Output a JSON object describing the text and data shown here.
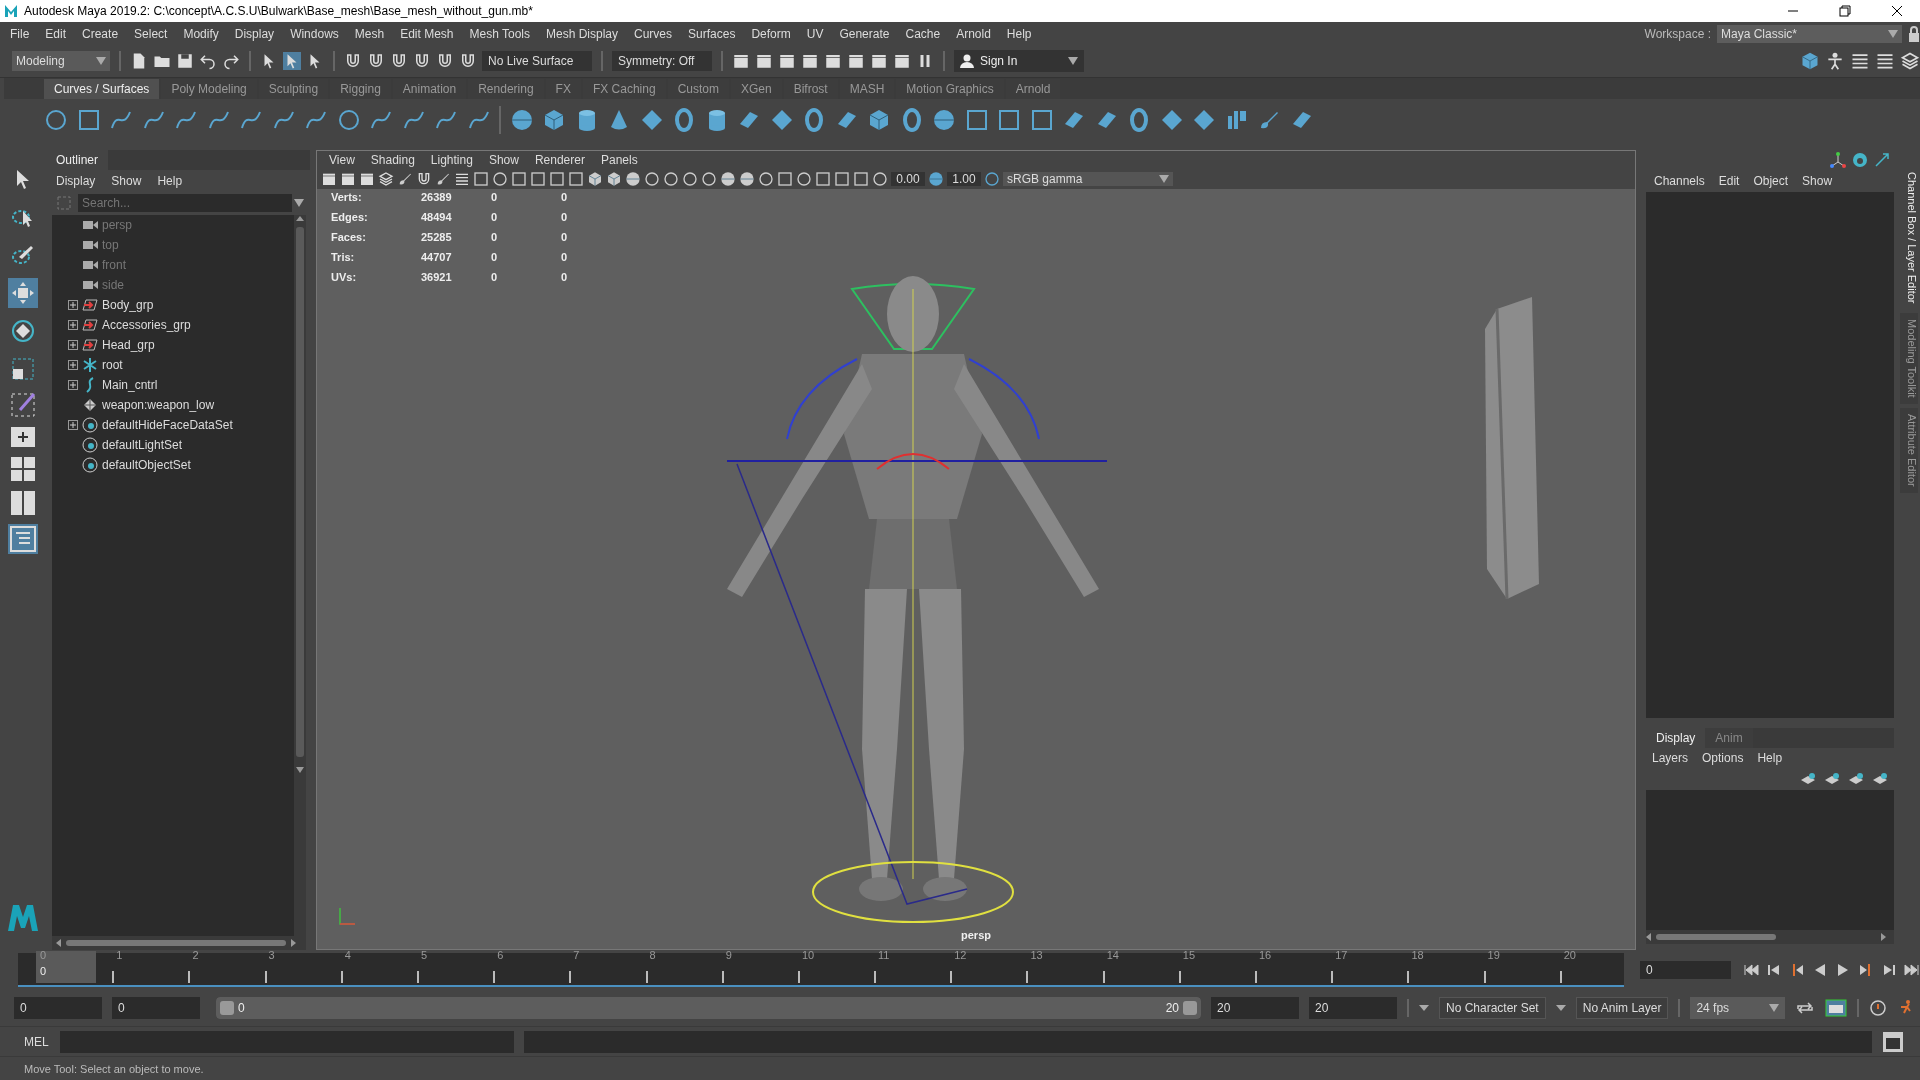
{
  "window": {
    "title": "Autodesk Maya 2019.2: C:\\concept\\A.C.S.U\\Bulwark\\Base_mesh\\Base_mesh_without_gun.mb*"
  },
  "menu_bar": [
    "File",
    "Edit",
    "Create",
    "Select",
    "Modify",
    "Display",
    "Windows",
    "Mesh",
    "Edit Mesh",
    "Mesh Tools",
    "Mesh Display",
    "Curves",
    "Surfaces",
    "Deform",
    "UV",
    "Generate",
    "Cache",
    "Arnold",
    "Help"
  ],
  "status_line": {
    "mode": "Modeling",
    "live_surface": "No Live Surface",
    "symmetry": "Symmetry: Off",
    "sign_in": "Sign In",
    "workspace_label": "Workspace :",
    "workspace": "Maya Classic*"
  },
  "shelf": {
    "tabs": [
      {
        "label": "Curves / Surfaces",
        "selected": true
      },
      {
        "label": "Poly Modeling",
        "selected": false
      },
      {
        "label": "Sculpting",
        "selected": false
      },
      {
        "label": "Rigging",
        "selected": false
      },
      {
        "label": "Animation",
        "selected": false
      },
      {
        "label": "Rendering",
        "selected": false
      },
      {
        "label": "FX",
        "selected": false
      },
      {
        "label": "FX Caching",
        "selected": false
      },
      {
        "label": "Custom",
        "selected": false
      },
      {
        "label": "XGen",
        "selected": false
      },
      {
        "label": "Bifrost",
        "selected": false
      },
      {
        "label": "MASH",
        "selected": false
      },
      {
        "label": "Motion Graphics",
        "selected": false
      },
      {
        "label": "Arnold",
        "selected": false
      }
    ]
  },
  "toolbox": [
    {
      "kind": "select",
      "selected": false
    },
    {
      "kind": "lasso",
      "selected": false
    },
    {
      "kind": "paint",
      "selected": false
    },
    {
      "kind": "move",
      "selected": true
    },
    {
      "kind": "rotate",
      "selected": false
    },
    {
      "kind": "scale",
      "selected": false
    }
  ],
  "outliner": {
    "title": "Outliner",
    "menu": [
      "Display",
      "Show",
      "Help"
    ],
    "search": {
      "placeholder": "Search..."
    },
    "items": [
      {
        "label": "persp",
        "kind": "camera",
        "expandable": false,
        "hidden": true
      },
      {
        "label": "top",
        "kind": "camera",
        "expandable": false,
        "hidden": true
      },
      {
        "label": "front",
        "kind": "camera",
        "expandable": false,
        "hidden": true
      },
      {
        "label": "side",
        "kind": "camera",
        "expandable": false,
        "hidden": true
      },
      {
        "label": "Body_grp",
        "kind": "group",
        "expandable": true,
        "hidden": false
      },
      {
        "label": "Accessories_grp",
        "kind": "group",
        "expandable": true,
        "hidden": false
      },
      {
        "label": "Head_grp",
        "kind": "group",
        "expandable": true,
        "hidden": false
      },
      {
        "label": "root",
        "kind": "joint",
        "expandable": true,
        "hidden": false
      },
      {
        "label": "Main_cntrl",
        "kind": "curve",
        "expandable": true,
        "hidden": false
      },
      {
        "label": "weapon:weapon_low",
        "kind": "mesh",
        "expandable": false,
        "hidden": false
      },
      {
        "label": "defaultHideFaceDataSet",
        "kind": "set",
        "expandable": true,
        "hidden": false
      },
      {
        "label": "defaultLightSet",
        "kind": "set",
        "expandable": false,
        "hidden": false
      },
      {
        "label": "defaultObjectSet",
        "kind": "set",
        "expandable": false,
        "hidden": false
      }
    ]
  },
  "viewport": {
    "menu": [
      "View",
      "Shading",
      "Lighting",
      "Show",
      "Renderer",
      "Panels"
    ],
    "exposure": "0.00",
    "gamma": "1.00",
    "color_space": "sRGB gamma",
    "stats": [
      {
        "label": "Verts:",
        "values": [
          "26389",
          "0",
          "0"
        ]
      },
      {
        "label": "Edges:",
        "values": [
          "48494",
          "0",
          "0"
        ]
      },
      {
        "label": "Faces:",
        "values": [
          "25285",
          "0",
          "0"
        ]
      },
      {
        "label": "Tris:",
        "values": [
          "44707",
          "0",
          "0"
        ]
      },
      {
        "label": "UVs:",
        "values": [
          "36921",
          "0",
          "0"
        ]
      }
    ],
    "camera_label": "persp"
  },
  "channel_box": {
    "menu": [
      "Channels",
      "Edit",
      "Object",
      "Show"
    ]
  },
  "layer_editor": {
    "tabs": [
      {
        "label": "Display",
        "selected": true
      },
      {
        "label": "Anim",
        "selected": false
      }
    ],
    "menu": [
      "Layers",
      "Options",
      "Help"
    ]
  },
  "side_tabs": [
    {
      "label": "Channel Box / Layer Editor",
      "selected": true
    },
    {
      "label": "Modeling Toolkit",
      "selected": false
    },
    {
      "label": "Attribute Editor",
      "selected": false
    }
  ],
  "timeline": {
    "ticks": [
      {
        "label": "0",
        "selected": true
      },
      {
        "label": "1",
        "selected": false
      },
      {
        "label": "2",
        "selected": false
      },
      {
        "label": "3",
        "selected": false
      },
      {
        "label": "4",
        "selected": false
      },
      {
        "label": "5",
        "selected": false
      },
      {
        "label": "6",
        "selected": false
      },
      {
        "label": "7",
        "selected": false
      },
      {
        "label": "8",
        "selected": false
      },
      {
        "label": "9",
        "selected": false
      },
      {
        "label": "10",
        "selected": false
      },
      {
        "label": "11",
        "selected": false
      },
      {
        "label": "12",
        "selected": false
      },
      {
        "label": "13",
        "selected": false
      },
      {
        "label": "14",
        "selected": false
      },
      {
        "label": "15",
        "selected": false
      },
      {
        "label": "16",
        "selected": false
      },
      {
        "label": "17",
        "selected": false
      },
      {
        "label": "18",
        "selected": false
      },
      {
        "label": "19",
        "selected": false
      },
      {
        "label": "20",
        "selected": false
      }
    ],
    "current_marker": "0",
    "current_frame": "0"
  },
  "range": {
    "level": 1,
    "start": "0",
    "playback_start": "0",
    "slider_start": "0",
    "slider_end": "20",
    "playback_end": "20",
    "end": "20",
    "character_set": "No Character Set",
    "anim_layer": "No Anim Layer",
    "fps": "24 fps"
  },
  "command_line": {
    "label": "MEL"
  },
  "help_line": "Move Tool: Select an object to move."
}
